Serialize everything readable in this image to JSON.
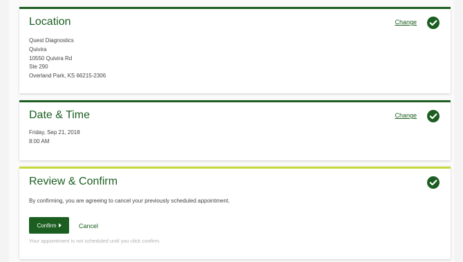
{
  "colors": {
    "brand_green": "#1b5e20",
    "active_accent": "#c5d93a",
    "muted_text": "#b0b0b0"
  },
  "location": {
    "title": "Location",
    "change_label": "Change",
    "lines": [
      "Quest Diagnostics",
      "Quivira",
      "10550 Quivira Rd",
      "Ste 290",
      "Overland Park, KS 66215-2306"
    ],
    "status_icon": "check-circle-icon"
  },
  "datetime": {
    "title": "Date & Time",
    "change_label": "Change",
    "date": "Friday, Sep 21, 2018",
    "time": "8:00 AM",
    "status_icon": "check-circle-icon"
  },
  "review": {
    "title": "Review & Confirm",
    "message": "By confirming, you are agreeing to cancel your previously scheduled appointment.",
    "confirm_label": "Confirm",
    "cancel_label": "Cancel",
    "footnote": "Your appointment is not scheduled until you click confirm.",
    "status_icon": "check-circle-icon"
  }
}
